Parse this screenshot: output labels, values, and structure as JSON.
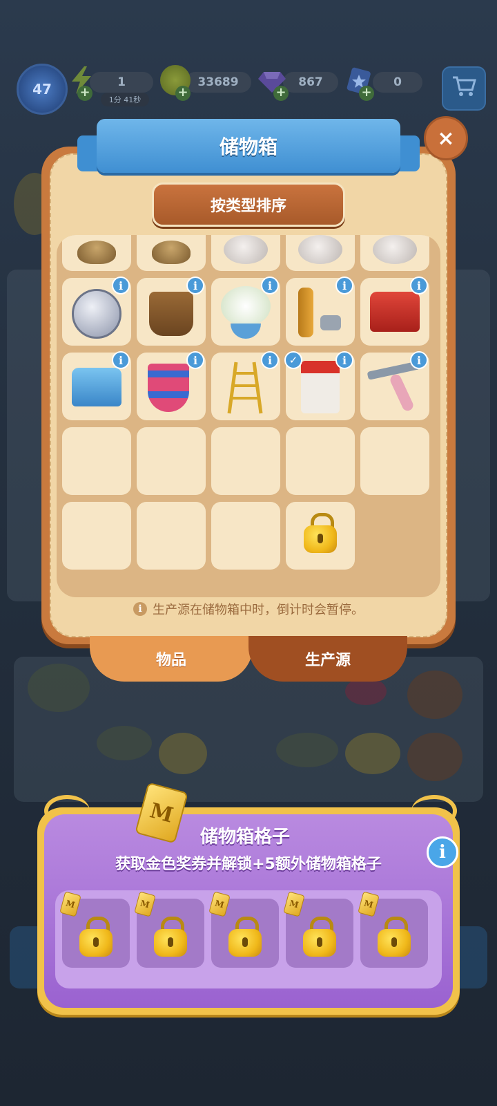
{
  "hud": {
    "level": "47",
    "energy_value": "1",
    "energy_timer": "1分 41秒",
    "coins_value": "33689",
    "gems_value": "867",
    "tickets_value": "0",
    "plus_label": "+",
    "cart_icon": "cart-icon"
  },
  "storage": {
    "title": "储物箱",
    "close_label": "×",
    "sort_button_label": "按类型排序",
    "info_label": "i",
    "check_label": "✓",
    "hint": "生产源在储物箱中时，倒计时会暂停。",
    "tabs": [
      {
        "label": "物品",
        "active": true
      },
      {
        "label": "生产源",
        "active": false
      }
    ],
    "rows": [
      [
        {
          "item": "sack",
          "info": false
        },
        {
          "item": "sack",
          "info": false
        },
        {
          "item": "piggy-bank",
          "info": false
        },
        {
          "item": "piggy-bank",
          "info": false
        },
        {
          "item": "piggy-bank",
          "info": false
        }
      ],
      [
        {
          "item": "silver-coin",
          "info": true
        },
        {
          "item": "wood-bucket",
          "info": true
        },
        {
          "item": "flower-bowl",
          "info": true
        },
        {
          "item": "pipe-and-bolts",
          "info": true
        },
        {
          "item": "red-chest",
          "info": true
        }
      ],
      [
        {
          "item": "blue-chest",
          "info": true
        },
        {
          "item": "knitted-sock",
          "info": true
        },
        {
          "item": "ladder",
          "info": true
        },
        {
          "item": "paint-bag",
          "info": true,
          "checked": true
        },
        {
          "item": "squeegee",
          "info": true
        }
      ],
      [
        {
          "item": "empty"
        },
        {
          "item": "empty"
        },
        {
          "item": "empty"
        },
        {
          "item": "empty"
        },
        {
          "item": "empty"
        }
      ],
      [
        {
          "item": "empty"
        },
        {
          "item": "empty"
        },
        {
          "item": "empty"
        },
        {
          "item": "locked"
        }
      ]
    ]
  },
  "promo": {
    "title": "储物箱格子",
    "subtitle": "获取金色奖券并解锁+5额外储物箱格子",
    "info_label": "i",
    "ticket_letter": "M",
    "locked_slots": 5
  },
  "colors": {
    "panel": "#f1d6a6",
    "panel_border": "#c97a3e",
    "ribbon": "#3f8fd2",
    "promo": "#9a62d0",
    "gold": "#f1c24a"
  }
}
